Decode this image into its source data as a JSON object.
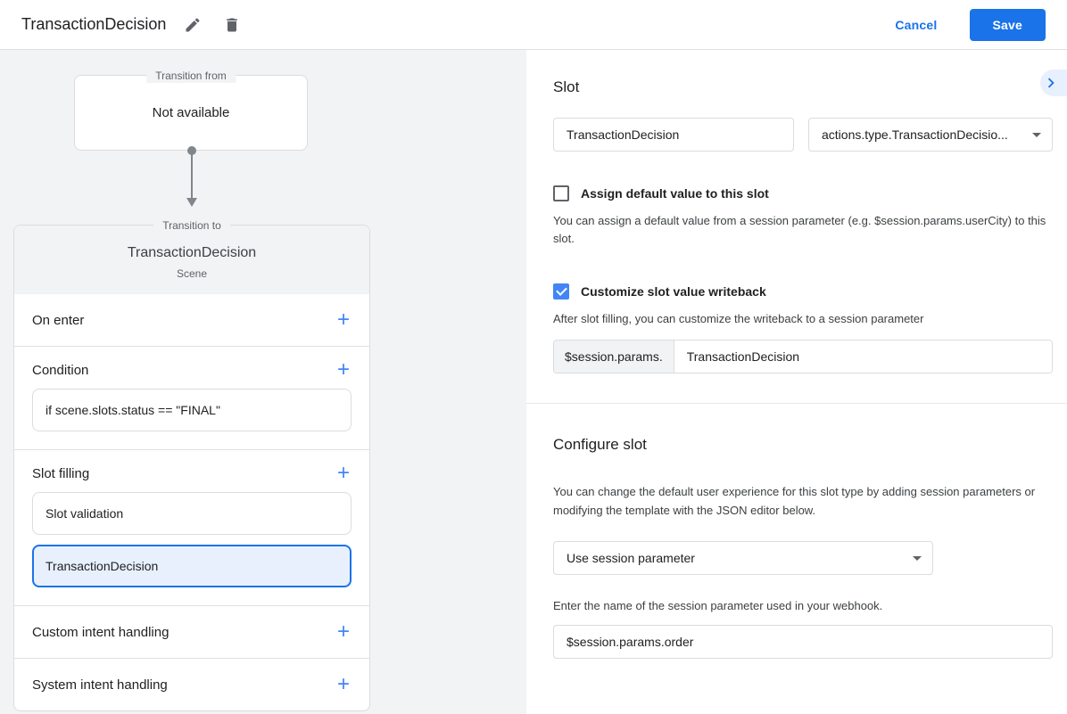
{
  "colors": {
    "accent": "#1a73e8",
    "checkbox_checked": "#4285f4",
    "selected_item_bg": "#e8f0fe",
    "panel_bg": "#f2f3f4"
  },
  "icons": {
    "add": "+",
    "edit": "pencil",
    "delete": "trash",
    "expand": "chevron-right",
    "dropdown": "caret-down"
  },
  "header": {
    "title": "TransactionDecision",
    "cancel_label": "Cancel",
    "save_label": "Save"
  },
  "diagram": {
    "from_legend": "Transition from",
    "from_content": "Not available",
    "to_legend": "Transition to",
    "scene_title": "TransactionDecision",
    "scene_subtitle": "Scene",
    "on_enter_label": "On enter",
    "condition_label": "Condition",
    "condition_value": "if scene.slots.status == \"FINAL\"",
    "slot_filling_label": "Slot filling",
    "slot_items": [
      {
        "label": "Slot validation",
        "selected": false
      },
      {
        "label": "TransactionDecision",
        "selected": true
      }
    ],
    "custom_intent_label": "Custom intent handling",
    "system_intent_label": "System intent handling"
  },
  "slot_panel": {
    "title": "Slot",
    "name_value": "TransactionDecision",
    "type_value": "actions.type.TransactionDecisio...",
    "assign_default": {
      "label": "Assign default value to this slot",
      "checked": false,
      "description": "You can assign a default value from a session parameter (e.g. $session.params.userCity) to this slot."
    },
    "writeback": {
      "label": "Customize slot value writeback",
      "checked": true,
      "description": "After slot filling, you can customize the writeback to a session parameter",
      "prefix": "$session.params.",
      "value": "TransactionDecision"
    }
  },
  "configure_panel": {
    "title": "Configure slot",
    "description": "You can change the default user experience for this slot type by adding session parameters or modifying the template with the JSON editor below.",
    "method_value": "Use session parameter",
    "param_label": "Enter the name of the session parameter used in your webhook.",
    "param_value": "$session.params.order"
  }
}
